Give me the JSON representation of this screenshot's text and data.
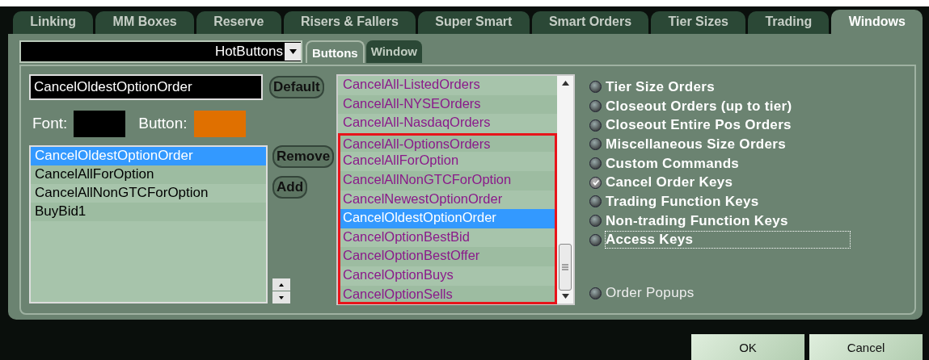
{
  "tabs": [
    {
      "label": "Linking",
      "selected": false
    },
    {
      "label": "MM Boxes",
      "selected": false
    },
    {
      "label": "Reserve",
      "selected": false
    },
    {
      "label": "Risers & Fallers",
      "selected": false
    },
    {
      "label": "Super Smart",
      "selected": false
    },
    {
      "label": "Smart Orders",
      "selected": false
    },
    {
      "label": "Tier Sizes",
      "selected": false
    },
    {
      "label": "Trading",
      "selected": false
    },
    {
      "label": "Windows",
      "selected": true
    }
  ],
  "window_select": {
    "value": "HotButtons"
  },
  "subtabs": [
    {
      "label": "Buttons",
      "selected": true
    },
    {
      "label": "Window",
      "selected": false
    }
  ],
  "name_field": {
    "value": "CancelOldestOptionOrder"
  },
  "default_button": "Default",
  "swatches": [
    {
      "label": "Font:",
      "color": "#000000"
    },
    {
      "label": "Button:",
      "color": "#e07000"
    }
  ],
  "assigned": [
    {
      "label": "CancelOldestOptionOrder",
      "selected": true
    },
    {
      "label": "CancelAllForOption",
      "selected": false
    },
    {
      "label": "CancelAllNonGTCForOption",
      "selected": false
    },
    {
      "label": "BuyBid1",
      "selected": false
    }
  ],
  "remove_button": "Remove",
  "add_button": "Add",
  "available": [
    {
      "label": "CancelAll-ListedOrders",
      "selected": false,
      "highlighted": false
    },
    {
      "label": "CancelAll-NYSEOrders",
      "selected": false,
      "highlighted": false
    },
    {
      "label": "CancelAll-NasdaqOrders",
      "selected": false,
      "highlighted": false
    },
    {
      "label": "CancelAll-OptionsOrders",
      "selected": false,
      "highlighted": true
    },
    {
      "label": "CancelAllForOption",
      "selected": false,
      "highlighted": true
    },
    {
      "label": "CancelAllNonGTCForOption",
      "selected": false,
      "highlighted": true
    },
    {
      "label": "CancelNewestOptionOrder",
      "selected": false,
      "highlighted": true
    },
    {
      "label": "CancelOldestOptionOrder",
      "selected": true,
      "highlighted": true
    },
    {
      "label": "CancelOptionBestBid",
      "selected": false,
      "highlighted": true
    },
    {
      "label": "CancelOptionBestOffer",
      "selected": false,
      "highlighted": true
    },
    {
      "label": "CancelOptionBuys",
      "selected": false,
      "highlighted": true
    },
    {
      "label": "CancelOptionSells",
      "selected": false,
      "highlighted": true
    }
  ],
  "categories": [
    {
      "label": "Tier Size Orders",
      "selected": false,
      "focused": false
    },
    {
      "label": "Closeout Orders (up to tier)",
      "selected": false,
      "focused": false
    },
    {
      "label": "Closeout Entire Pos Orders",
      "selected": false,
      "focused": false
    },
    {
      "label": "Miscellaneous Size Orders",
      "selected": false,
      "focused": false
    },
    {
      "label": "Custom Commands",
      "selected": false,
      "focused": false
    },
    {
      "label": "Cancel Order Keys",
      "selected": true,
      "focused": false
    },
    {
      "label": "Trading Function Keys",
      "selected": false,
      "focused": false
    },
    {
      "label": "Non-trading Function Keys",
      "selected": false,
      "focused": false
    },
    {
      "label": "Access Keys",
      "selected": false,
      "focused": true
    }
  ],
  "order_popups": {
    "label": "Order Popups",
    "selected": false
  },
  "buttons": [
    "OK",
    "Cancel"
  ]
}
